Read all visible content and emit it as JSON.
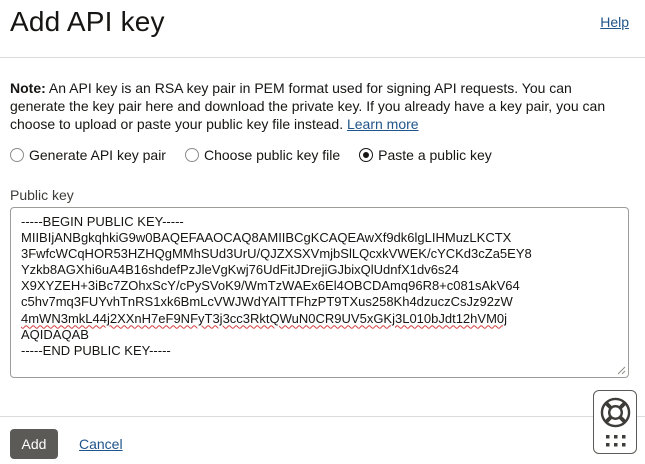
{
  "header": {
    "title": "Add API key",
    "help_label": "Help"
  },
  "note": {
    "label": "Note:",
    "text": " An API key is an RSA key pair in PEM format used for signing API requests. You can generate the key pair here and download the private key. If you already have a key pair, you can choose to upload or paste your public key file instead. ",
    "learn_more": "Learn more"
  },
  "options": {
    "generate": "Generate API key pair",
    "choose": "Choose public key file",
    "paste": "Paste a public key",
    "selected": "paste"
  },
  "public_key": {
    "label": "Public key",
    "lines": [
      "-----BEGIN PUBLIC KEY-----",
      "MIIBIjANBgkqhkiG9w0BAQEFAAOCAQ8AMIIBCgKCAQEAwXf9dk6lgLIHMuzLKCTX",
      "3FwfcWCqHOR53HZHQgMMhSUd3UrU/QJZXSXVmjbSlLQcxkVWEK/cYCKd3cZa5EY8",
      "Yzkb8AGXhi6uA4B16shdefPzJleVgKwj76UdFitJDrejiGJbixQlUdnfX1dv6s24",
      "X9XYZEH+3iBc7ZOhxScY/cPySVoK9/WmTzWAEx6El4OBCDAmq96R8+c081sAkV64",
      "c5hv7mq3FUYvhTnRS1xk6BmLcVWJWdYAlTTFhzPT9TXus258Kh4dzuczCsJz92zW",
      "4mWN3mkL44j2XXnH7eF9NFyT3j3cc3RktQWuN0CR9UV5xGKj3L010bJdt12hVM0j",
      "AQIDAQAB",
      "-----END PUBLIC KEY-----"
    ]
  },
  "footer": {
    "add_label": "Add",
    "cancel_label": "Cancel"
  }
}
